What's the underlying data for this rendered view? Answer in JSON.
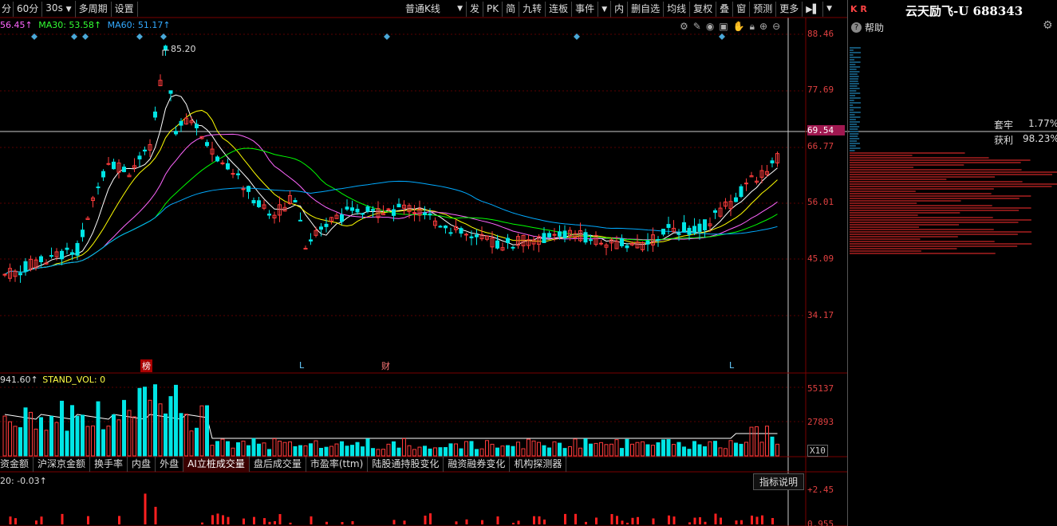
{
  "toolbar": {
    "left": [
      "分",
      "60分",
      "30s",
      "多周期",
      "设置"
    ],
    "kline_select": "普通K线",
    "right": [
      "发",
      "PK",
      "简",
      "九转",
      "连板",
      "事件",
      "内",
      "删自选",
      "均线",
      "复权",
      "叠",
      "窗",
      "预测",
      "更多"
    ]
  },
  "ma_legend": {
    "ma5": "56.45↑",
    "ma30": "MA30: 53.58↑",
    "ma60": "MA60: 51.17↑"
  },
  "price_axis": [
    "88.46",
    "77.69",
    "69.54",
    "66.77",
    "56.01",
    "45.09",
    "34.17"
  ],
  "peak_label": "85.20",
  "markers": {
    "bang": "榜",
    "l1": "L",
    "cai": "财",
    "l2": "L"
  },
  "vol_legend": {
    "value": "941.60↑",
    "std": "STAND_VOL: 0"
  },
  "vol_axis": [
    "55137",
    "27893",
    "X10"
  ],
  "tabs": [
    "资金额",
    "沪深京金额",
    "换手率",
    "内盘",
    "外盘",
    "AI立桩成交量",
    "盘后成交量",
    "市盈率(ttm)",
    "陆股通持股变化",
    "融资融券变化",
    "机构探测器"
  ],
  "ind_legend": "20: -0.03↑",
  "ind_button": "指标说明",
  "ind_axis": [
    "+2.45",
    "0.955"
  ],
  "right_panel": {
    "kr": "K R",
    "stock": "云天励飞-U 688343",
    "help": "帮助",
    "tao": "套牢",
    "tao_val": "1.77%",
    "profit": "获利",
    "profit_val": "98.23%"
  },
  "colors": {
    "up": "#ff3c3c",
    "down": "#00e5e5",
    "ma5": "#ffffff",
    "ma10": "#ffff00",
    "ma20": "#ff66ff",
    "ma30": "#00ff00",
    "ma60": "#00aaff"
  }
}
